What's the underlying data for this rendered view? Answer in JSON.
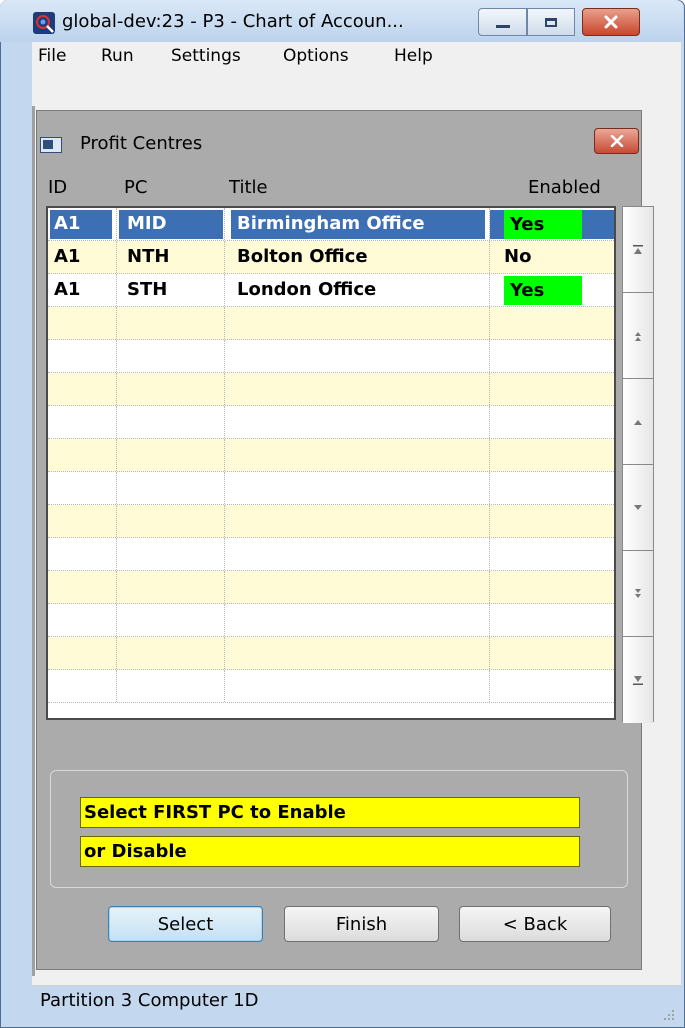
{
  "window": {
    "title": "global-dev:23 - P3 - Chart of Accoun...",
    "icon": "app-globe-icon"
  },
  "menu": [
    "File",
    "Run",
    "Settings",
    "Options",
    "Help"
  ],
  "panel": {
    "title": "Profit Centres",
    "icon": "window-icon"
  },
  "grid": {
    "headers": {
      "id": "ID",
      "pc": "PC",
      "title": "Title",
      "enabled": "Enabled"
    },
    "rows": [
      {
        "id": "A1",
        "pc": "MID",
        "title": "Birmingham Office",
        "enabled": "Yes"
      },
      {
        "id": "A1",
        "pc": "NTH",
        "title": "Bolton Office",
        "enabled": "No"
      },
      {
        "id": "A1",
        "pc": "STH",
        "title": "London Office",
        "enabled": "Yes"
      }
    ],
    "selected_row": 0,
    "enabled_color": "#00ff00",
    "selection_color": "#3d6fb5",
    "alt_row_color": "#fffbd7"
  },
  "scroll_buttons": [
    "scroll-top-icon",
    "scroll-page-up-icon",
    "scroll-up-icon",
    "scroll-down-icon",
    "scroll-page-down-icon",
    "scroll-bottom-icon"
  ],
  "message": {
    "line1": "Select FIRST PC to Enable",
    "line2": "or Disable",
    "color": "#ffff00"
  },
  "buttons": {
    "select": "Select",
    "finish": "Finish",
    "back": "< Back"
  },
  "status": "Partition 3 Computer 1D"
}
